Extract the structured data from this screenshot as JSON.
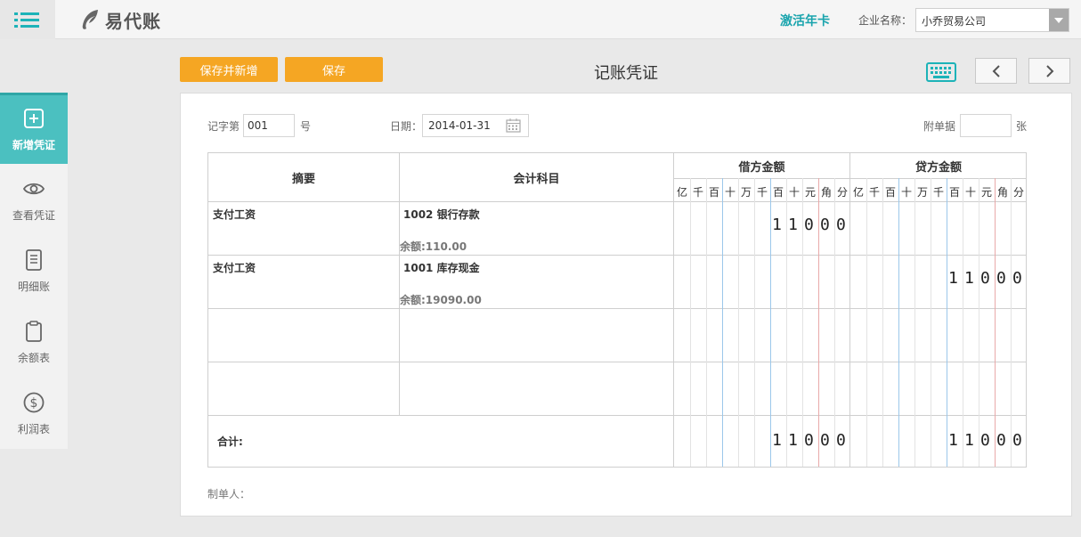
{
  "header": {
    "logo_text": "易代账",
    "activate_label": "激活年卡",
    "company_label": "企业名称：",
    "company_value": "小乔贸易公司"
  },
  "sidebar": {
    "items": [
      {
        "label": "新增凭证",
        "icon": "plus-square-icon",
        "active": true
      },
      {
        "label": "查看凭证",
        "icon": "eye-icon",
        "active": false
      },
      {
        "label": "明细账",
        "icon": "document-icon",
        "active": false
      },
      {
        "label": "余额表",
        "icon": "clipboard-icon",
        "active": false
      },
      {
        "label": "利润表",
        "icon": "dollar-circle-icon",
        "active": false
      }
    ]
  },
  "toolbar": {
    "save_new_label": "保存并新增",
    "save_label": "保存",
    "title": "记账凭证"
  },
  "voucher": {
    "word_label": "记字第",
    "word_value": "001",
    "word_suffix": "号",
    "date_label": "日期：",
    "date_value": "2014-01-31",
    "attach_label": "附单据",
    "attach_value": "",
    "attach_suffix": "张",
    "col_summary": "摘要",
    "col_account": "会计科目",
    "col_debit": "借方金额",
    "col_credit": "贷方金额",
    "digit_units": [
      "亿",
      "千",
      "百",
      "十",
      "万",
      "千",
      "百",
      "十",
      "元",
      "角",
      "分"
    ],
    "rows": [
      {
        "summary": "支付工资",
        "account": "1002 银行存款",
        "balance": "余额:110.00",
        "debit": "11000",
        "credit": ""
      },
      {
        "summary": "支付工资",
        "account": "1001 库存现金",
        "balance": "余额:19090.00",
        "debit": "",
        "credit": "11000"
      },
      {
        "summary": "",
        "account": "",
        "balance": "",
        "debit": "",
        "credit": ""
      },
      {
        "summary": "",
        "account": "",
        "balance": "",
        "debit": "",
        "credit": ""
      }
    ],
    "total_label": "合计:",
    "total_debit": "11000",
    "total_credit": "11000",
    "maker_label": "制单人："
  },
  "colors": {
    "accent": "#4bc0c0",
    "orange": "#f5a623",
    "teal_text": "#1aa4ad"
  }
}
